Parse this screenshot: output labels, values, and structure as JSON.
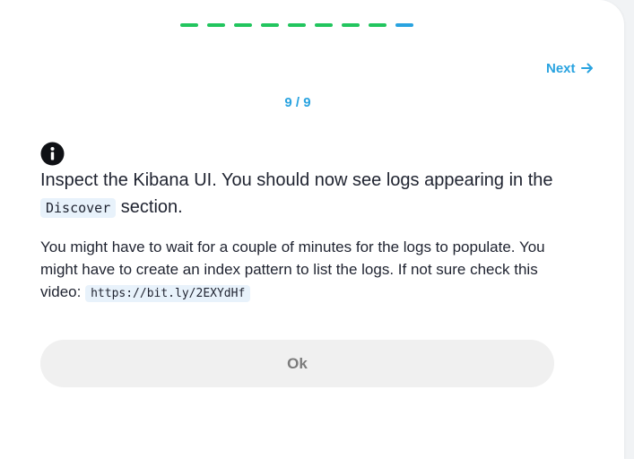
{
  "progress": {
    "total_steps": 9,
    "current_step": 9,
    "completed_color": "#22c55e",
    "current_color": "#29a3e0"
  },
  "nav": {
    "next_label": "Next",
    "next_icon": "arrow-right-icon"
  },
  "step_counter": "9 / 9",
  "content": {
    "info_icon": "info-icon",
    "headline_before": "Inspect the Kibana UI. You should now see logs appearing in the ",
    "headline_code": "Discover",
    "headline_after": " section.",
    "body_text": "You might have to wait for a couple of minutes for the logs to populate. You might have to create an index pattern to list the logs. If not sure check this video: ",
    "body_code": "https://bit.ly/2EXYdHf"
  },
  "actions": {
    "ok_label": "Ok"
  },
  "colors": {
    "accent": "#29a3e0",
    "text": "#1f2330",
    "code_bg": "#e8f2fb",
    "button_bg": "#f0f0f0"
  }
}
